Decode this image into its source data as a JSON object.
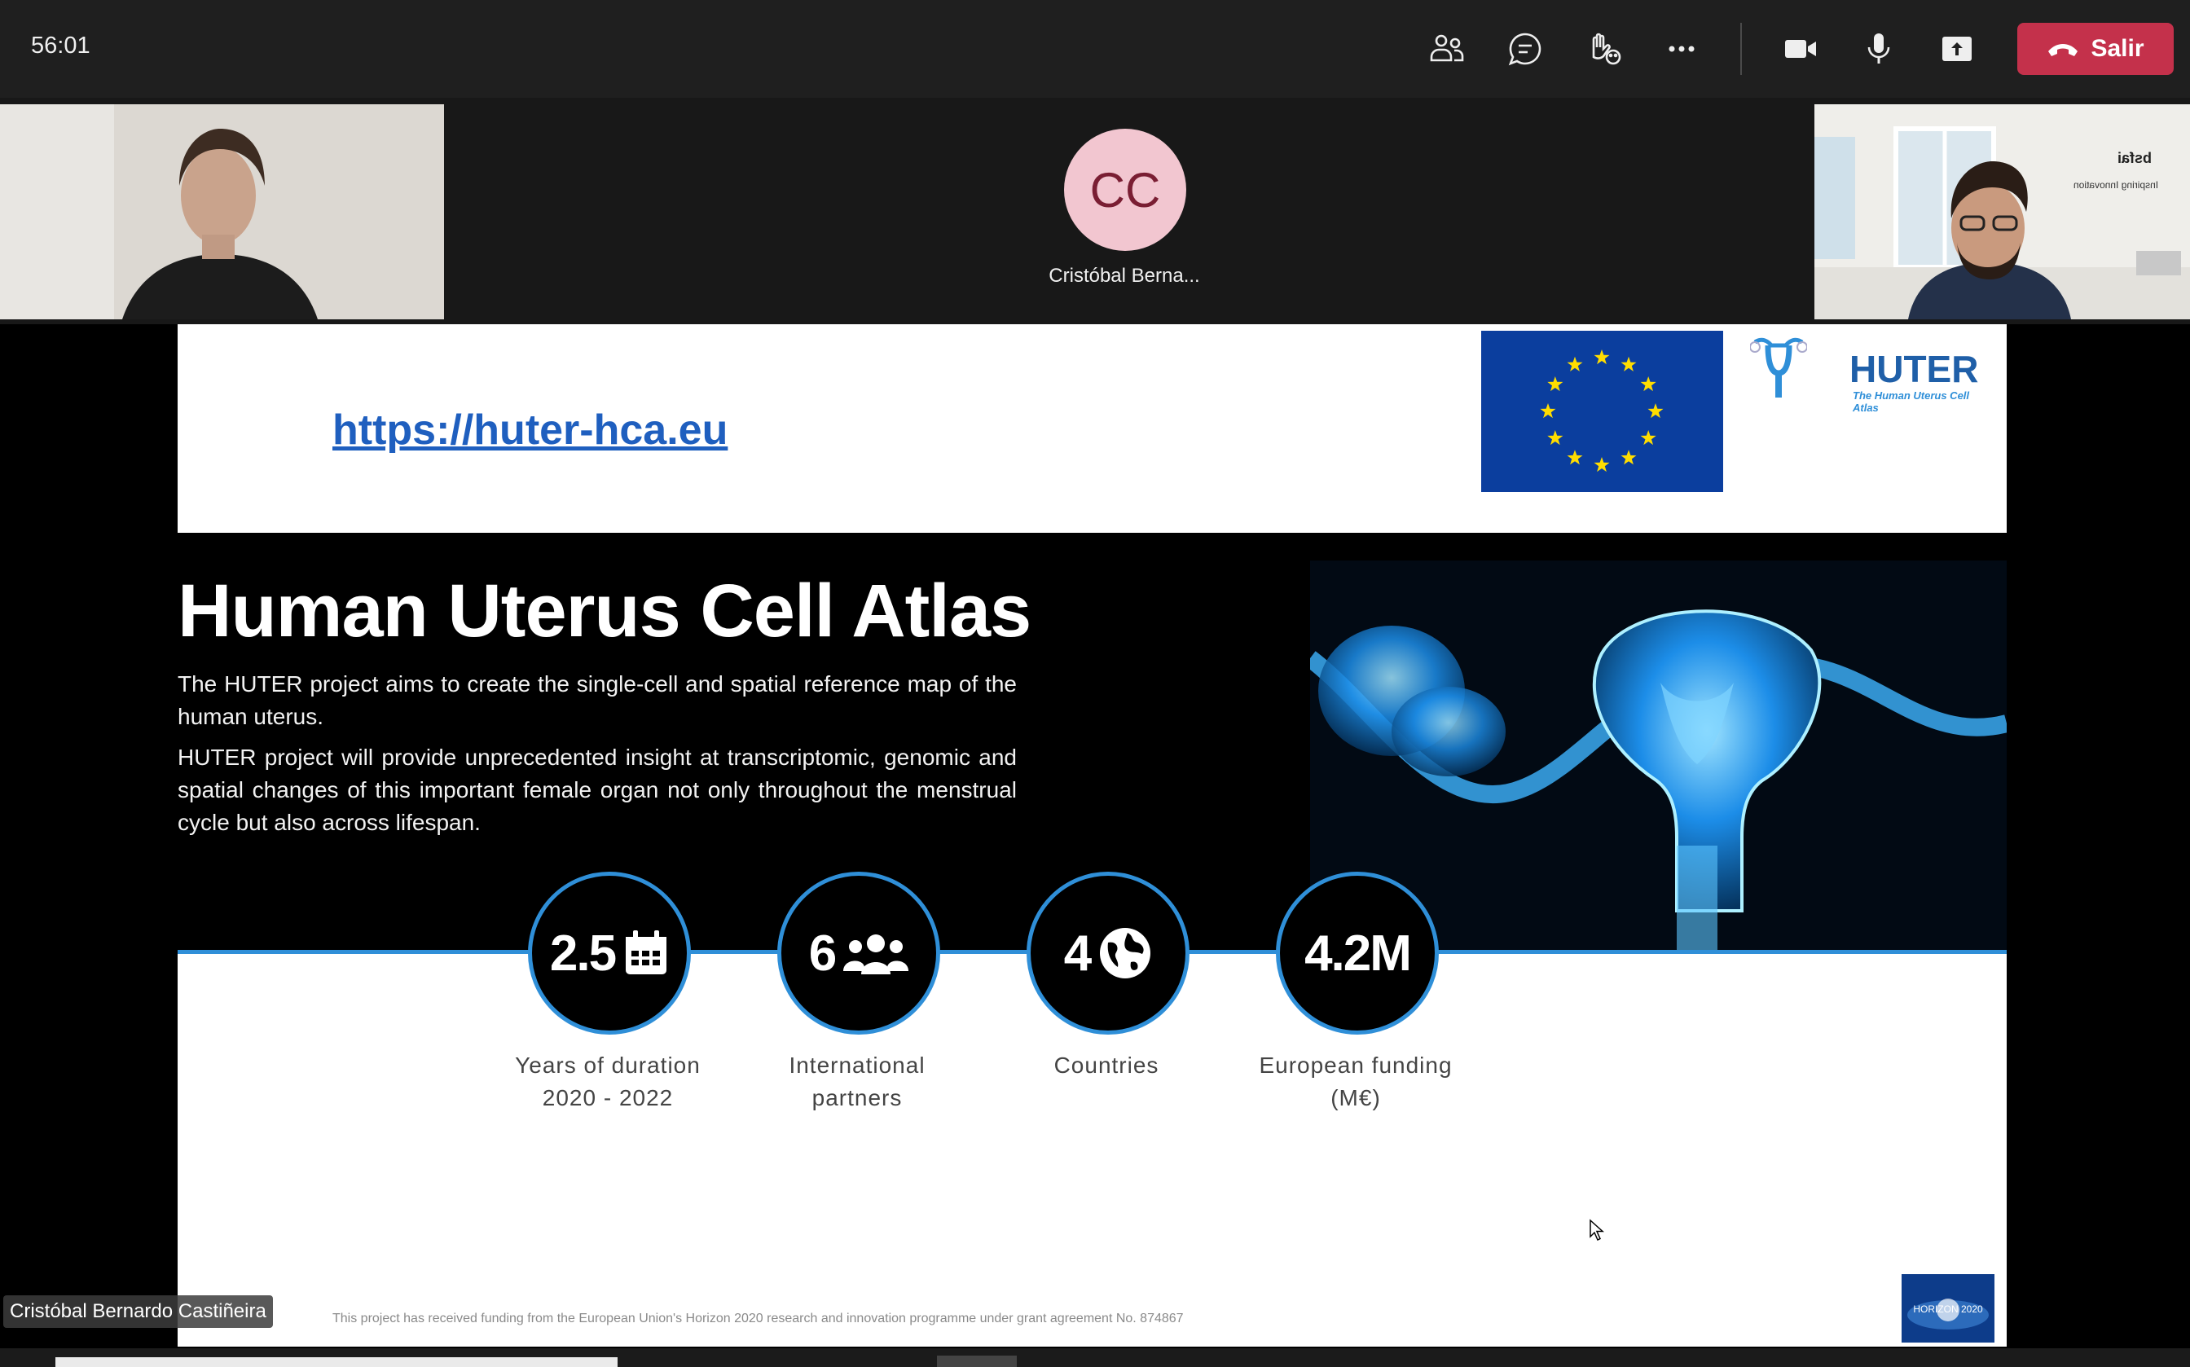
{
  "meeting": {
    "timer": "56:01",
    "leave_label": "Salir",
    "toolbar": [
      {
        "name": "people-icon"
      },
      {
        "name": "chat-icon"
      },
      {
        "name": "raise-hand-icon"
      },
      {
        "name": "more-options-icon"
      },
      {
        "name": "camera-icon"
      },
      {
        "name": "microphone-icon"
      },
      {
        "name": "share-screen-icon"
      }
    ]
  },
  "participants": {
    "center_initials": "CC",
    "center_name": "Cristóbal Berna...",
    "speaker_name_tag": "Cristóbal Bernardo Castiñeira",
    "right_video_logo_text": "bsfai",
    "right_video_logo_subtext": "Inspiring Innovation"
  },
  "slide": {
    "url": "https://huter-hca.eu",
    "huter_logo_title": "HUTER",
    "huter_logo_subtitle": "The Human Uterus Cell Atlas",
    "title": "Human Uterus Cell Atlas",
    "paragraph1": "The HUTER project aims to create the single-cell and spatial reference map of the human uterus.",
    "paragraph2": "HUTER project will provide unprecedented insight at transcriptomic, genomic and spatial changes of this important female organ not only throughout the menstrual cycle but also across lifespan.",
    "stats": [
      {
        "value": "2.5",
        "icon": "calendar-icon",
        "label1": "Years of duration",
        "label2": "2020 - 2022"
      },
      {
        "value": "6",
        "icon": "group-icon",
        "label1": "International",
        "label2": "partners"
      },
      {
        "value": "4",
        "icon": "globe-icon",
        "label1": "Countries",
        "label2": ""
      },
      {
        "value": "4.2M",
        "icon": "",
        "label1": "European funding",
        "label2": "(M€)"
      }
    ],
    "footnote": "This project has received funding from the European  Union's Horizon 2020 research and innovation programme under grant agreement No. 874867",
    "horizon_badge_text": "HORIZON 2020"
  },
  "colors": {
    "leave_button": "#c4314b",
    "slide_accent_blue": "#2f8fd8",
    "url_blue": "#1f5fbf",
    "eu_blue": "#0b3e9e",
    "eu_star": "#ffdd00",
    "avatar_bg": "#f2c6d0"
  }
}
